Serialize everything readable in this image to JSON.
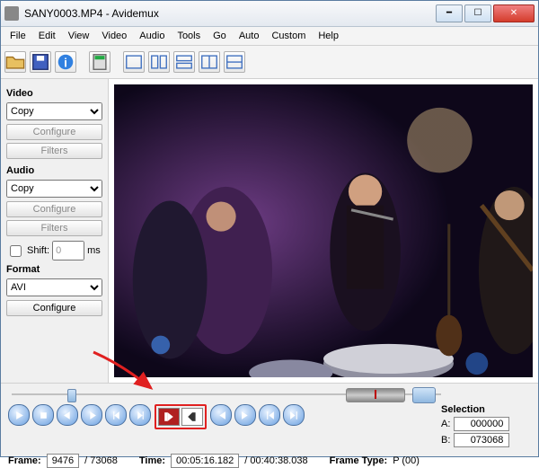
{
  "window": {
    "title": "SANY0003.MP4 - Avidemux"
  },
  "menu": [
    "File",
    "Edit",
    "View",
    "Video",
    "Audio",
    "Tools",
    "Go",
    "Auto",
    "Custom",
    "Help"
  ],
  "sidebar": {
    "video": {
      "label": "Video",
      "codec": "Copy",
      "configure": "Configure",
      "filters": "Filters"
    },
    "audio": {
      "label": "Audio",
      "codec": "Copy",
      "configure": "Configure",
      "filters": "Filters",
      "shift_label": "Shift:",
      "shift_value": "0",
      "shift_unit": "ms"
    },
    "format": {
      "label": "Format",
      "value": "AVI",
      "configure": "Configure"
    }
  },
  "selection": {
    "label": "Selection",
    "a_label": "A:",
    "a": "000000",
    "b_label": "B:",
    "b": "073068"
  },
  "status": {
    "frame_label": "Frame:",
    "frame": "9476",
    "frame_total": "/ 73068",
    "time_label": "Time:",
    "time": "00:05:16.182",
    "time_total": "/ 00:40:38.038",
    "frametype_label": "Frame Type:",
    "frametype": "P (00)"
  }
}
